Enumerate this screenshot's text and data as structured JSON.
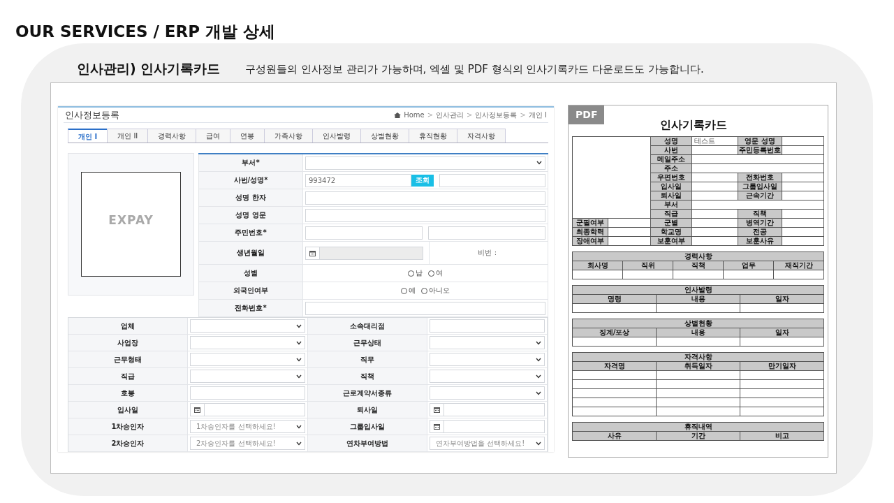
{
  "page_title": "OUR SERVICES / ERP 개발 상세",
  "intro": {
    "heading": "인사관리) 인사기록카드",
    "description": "구성원들의 인사정보 관리가 가능하며, 엑셀 및 PDF 형식의 인사기록카드 다운로드도 가능합니다."
  },
  "form": {
    "title": "인사정보등록",
    "breadcrumb_separator": ">",
    "breadcrumb": [
      "Home",
      "인사관리",
      "인사정보등록",
      "개인 I"
    ],
    "tabs": [
      {
        "label": "개인 I",
        "selected": true
      },
      {
        "label": "개인 II",
        "selected": false
      },
      {
        "label": "경력사항",
        "selected": false
      },
      {
        "label": "급여",
        "selected": false
      },
      {
        "label": "연봉",
        "selected": false
      },
      {
        "label": "가족사항",
        "selected": false
      },
      {
        "label": "인사발령",
        "selected": false
      },
      {
        "label": "상벌현황",
        "selected": false
      },
      {
        "label": "휴직현황",
        "selected": false
      },
      {
        "label": "자격사항",
        "selected": false
      }
    ],
    "photo_watermark": "EXPAY",
    "fields": [
      {
        "label": "부서*",
        "kind": "select"
      },
      {
        "label": "사번/성명*",
        "kind": "lookup",
        "value": "993472",
        "button": "조회"
      },
      {
        "label": "성명 한자",
        "kind": "text"
      },
      {
        "label": "성명 영문",
        "kind": "text"
      },
      {
        "label": "주민번호*",
        "kind": "split"
      },
      {
        "label": "생년월일",
        "kind": "date_note",
        "disabled": true,
        "note": "비번 :"
      },
      {
        "label": "성별",
        "kind": "radio",
        "options": [
          {
            "label": "남",
            "selected": false
          },
          {
            "label": "여",
            "selected": false
          }
        ]
      },
      {
        "label": "외국인여부",
        "kind": "radio",
        "options": [
          {
            "label": "예",
            "selected": false
          },
          {
            "label": "아니오",
            "selected": false
          }
        ]
      },
      {
        "label": "전화번호*",
        "kind": "text"
      }
    ],
    "details": [
      {
        "label": "업체",
        "kind": "select"
      },
      {
        "label": "소속대리점",
        "kind": "text"
      },
      {
        "label": "사업장",
        "kind": "select"
      },
      {
        "label": "근무상태",
        "kind": "select"
      },
      {
        "label": "근무형태",
        "kind": "select"
      },
      {
        "label": "직무",
        "kind": "select"
      },
      {
        "label": "직급",
        "kind": "select"
      },
      {
        "label": "직책",
        "kind": "select"
      },
      {
        "label": "호봉",
        "kind": "text"
      },
      {
        "label": "근로계약서종류",
        "kind": "select"
      },
      {
        "label": "입사일",
        "kind": "date"
      },
      {
        "label": "퇴사일",
        "kind": "date"
      },
      {
        "label": "1차승인자",
        "kind": "select",
        "placeholder": "1차승인자를 선택하세요!"
      },
      {
        "label": "그룹입사일",
        "kind": "date"
      },
      {
        "label": "2차승인자",
        "kind": "select",
        "placeholder": "2차승인자를 선택하세요!"
      },
      {
        "label": "연차부여방법",
        "kind": "select",
        "placeholder": "연차부여방법을 선택하세요!"
      }
    ]
  },
  "card": {
    "badge": "PDF",
    "title": "인사기록카드",
    "profile": [
      {
        "items": [
          {
            "label": "성명",
            "value": "테스트"
          },
          {
            "label": "영문 성명"
          }
        ]
      },
      {
        "items": [
          {
            "label": "사번"
          },
          {
            "label": "주민등록번호"
          }
        ]
      },
      {
        "items": [
          {
            "label": "메일주소"
          }
        ]
      },
      {
        "items": [
          {
            "label": "주소"
          }
        ]
      },
      {
        "items": [
          {
            "label": "우편번호"
          },
          {
            "label": "전화번호"
          }
        ]
      },
      {
        "items": [
          {
            "label": "입사일"
          },
          {
            "label": "그룹입사일"
          }
        ]
      },
      {
        "items": [
          {
            "label": "퇴사일"
          },
          {
            "label": "근속기간"
          }
        ]
      },
      {
        "items": [
          {
            "label": "부서"
          }
        ]
      },
      {
        "items": [
          {
            "label": "직급"
          },
          {
            "label": "직책"
          }
        ]
      },
      {
        "side": {
          "label": "군필여부"
        },
        "items": [
          {
            "label": "군별"
          },
          {
            "label": "병역기간"
          }
        ]
      },
      {
        "side": {
          "label": "최종학력"
        },
        "items": [
          {
            "label": "학교명"
          },
          {
            "label": "전공"
          }
        ]
      },
      {
        "side": {
          "label": "장애여부"
        },
        "items": [
          {
            "label": "보훈여부"
          },
          {
            "label": "보훈사유"
          }
        ]
      }
    ],
    "sections": [
      {
        "title": "경력사항",
        "columns": [
          "회사명",
          "직위",
          "직책",
          "업무",
          "재직기간"
        ],
        "rows": [
          {
            "kind": "blank"
          }
        ]
      },
      {
        "title": "인사발령",
        "columns": [
          "명령",
          "내용",
          "일자"
        ],
        "rows": [
          {
            "kind": "blank"
          }
        ]
      },
      {
        "title": "상벌현황",
        "columns": [
          "징계/포상",
          "내용",
          "일자"
        ],
        "rows": [
          {
            "kind": "blank"
          }
        ]
      },
      {
        "title": "자격사항",
        "columns": [
          "자격명",
          "취득일자",
          "만기일자"
        ],
        "rows": [
          {
            "kind": "blank"
          },
          {
            "kind": "blank"
          },
          {
            "kind": "blank"
          },
          {
            "kind": "blank"
          },
          {
            "kind": "blank"
          }
        ]
      },
      {
        "title": "휴직내역",
        "columns": [
          "사유",
          "기간",
          "비고"
        ]
      }
    ]
  }
}
